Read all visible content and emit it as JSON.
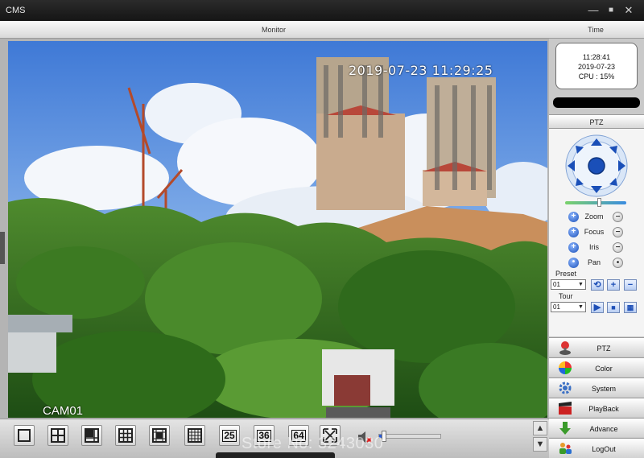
{
  "window": {
    "title": "CMS",
    "minimize": "—",
    "maximize": "■",
    "close": "✕"
  },
  "header": {
    "monitor": "Monitor",
    "time": "Time"
  },
  "clock": {
    "time": "11:28:41",
    "date": "2019-07-23",
    "cpu": "CPU : 15%"
  },
  "video": {
    "osd_timestamp": "2019-07-23 11:29:25",
    "camera_label": "CAM01"
  },
  "toolbar": {
    "layout_buttons": [
      "1",
      "4",
      "6",
      "9",
      "13",
      "16"
    ],
    "numeric_layouts": [
      "25",
      "36",
      "64"
    ],
    "watermark": "Store No: 3243030",
    "volume_level": 0.08
  },
  "ptz": {
    "title": "PTZ",
    "speed_level": 0.55,
    "controls": [
      "Zoom",
      "Focus",
      "Iris",
      "Pan"
    ],
    "preset_label": "Preset",
    "preset_value": "01",
    "tour_label": "Tour",
    "tour_value": "01"
  },
  "menu": [
    {
      "label": "PTZ",
      "icon": "joystick-icon"
    },
    {
      "label": "Color",
      "icon": "color-wheel-icon"
    },
    {
      "label": "System",
      "icon": "gear-icon"
    },
    {
      "label": "PlayBack",
      "icon": "clapperboard-icon"
    },
    {
      "label": "Advance",
      "icon": "down-arrow-icon"
    },
    {
      "label": "LogOut",
      "icon": "users-icon"
    }
  ],
  "colors": {
    "accent": "#1a4fb8",
    "panel": "#c9c9c9",
    "titlebar": "#1c1c1c"
  }
}
